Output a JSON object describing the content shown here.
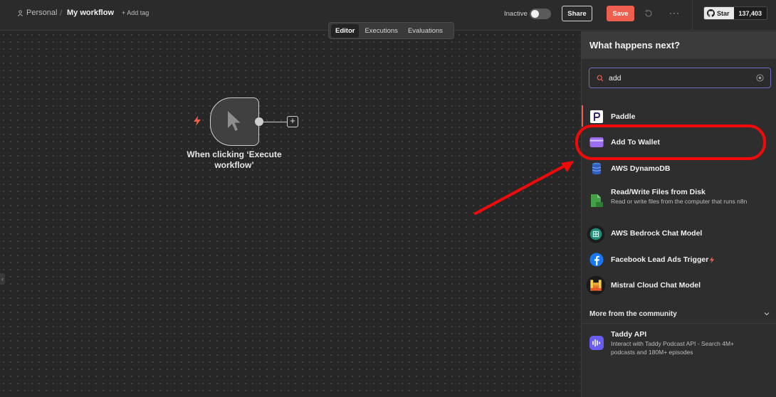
{
  "header": {
    "project": "Personal",
    "workflow_name": "My workflow",
    "add_tag": "+ Add tag",
    "status": "Inactive",
    "share_label": "Share",
    "save_label": "Save",
    "more_label": "···",
    "github_star_label": "Star",
    "github_star_count": "137,403"
  },
  "tabs": [
    {
      "label": "Editor",
      "active": true
    },
    {
      "label": "Executions",
      "active": false
    },
    {
      "label": "Evaluations",
      "active": false
    }
  ],
  "canvas": {
    "node_label": "When clicking ‘Execute workflow’",
    "add_node": "+"
  },
  "panel": {
    "title": "What happens next?",
    "search": {
      "value": "add",
      "placeholder": ""
    },
    "results": [
      {
        "name": "Paddle",
        "description": ""
      },
      {
        "name": "Add To Wallet",
        "description": ""
      },
      {
        "name": "AWS DynamoDB",
        "description": ""
      },
      {
        "name": "Read/Write Files from Disk",
        "description": "Read or write files from the computer that runs n8n"
      },
      {
        "name": "AWS Bedrock Chat Model",
        "description": ""
      },
      {
        "name": "Facebook Lead Ads Trigger",
        "description": ""
      },
      {
        "name": "Mistral Cloud Chat Model",
        "description": ""
      }
    ],
    "community_heading": "More from the community",
    "community_results": [
      {
        "name": "Taddy API",
        "description": "Interact with Taddy Podcast API - Search 4M+ podcasts and 180M+ episodes"
      }
    ]
  },
  "colors": {
    "accent": "#ee5f4f",
    "annotation": "#f00a0a",
    "search_border": "#6a6fbf"
  }
}
